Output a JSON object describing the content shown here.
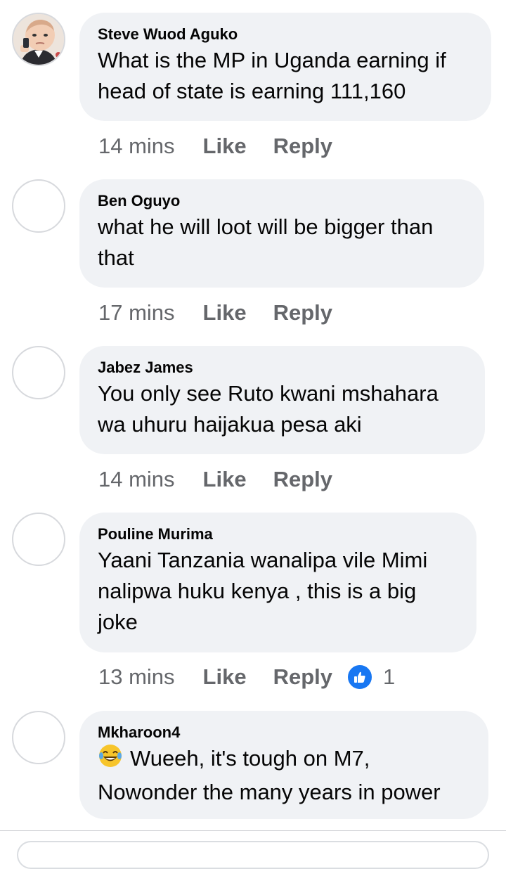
{
  "comments": [
    {
      "author": "Steve Wuod Aguko",
      "text": "What is the MP in Uganda earning if head of state is earning 111,160",
      "time": "14 mins",
      "like": "Like",
      "reply": "Reply"
    },
    {
      "author": "Ben Oguyo",
      "text": "what he will loot will be bigger than that",
      "time": "17 mins",
      "like": "Like",
      "reply": "Reply"
    },
    {
      "author": "Jabez James",
      "text": "You only see Ruto kwani mshahara wa uhuru haijakua pesa aki",
      "time": "14 mins",
      "like": "Like",
      "reply": "Reply"
    },
    {
      "author": "Pouline Murima",
      "text": "Yaani Tanzania wanalipa vile Mimi nalipwa huku kenya , this is a big joke",
      "time": "13 mins",
      "like": "Like",
      "reply": "Reply",
      "reaction_count": "1",
      "reaction_icon": "thumbs-up-icon"
    },
    {
      "author": "Mkharoon4",
      "text": "Wueeh, it's tough on M7, Nowonder the many years in power",
      "emoji": "laughing-tears-emoji"
    }
  ],
  "colors": {
    "bubble": "#f0f2f5",
    "meta": "#65676b",
    "like_badge": "#1877f2"
  }
}
